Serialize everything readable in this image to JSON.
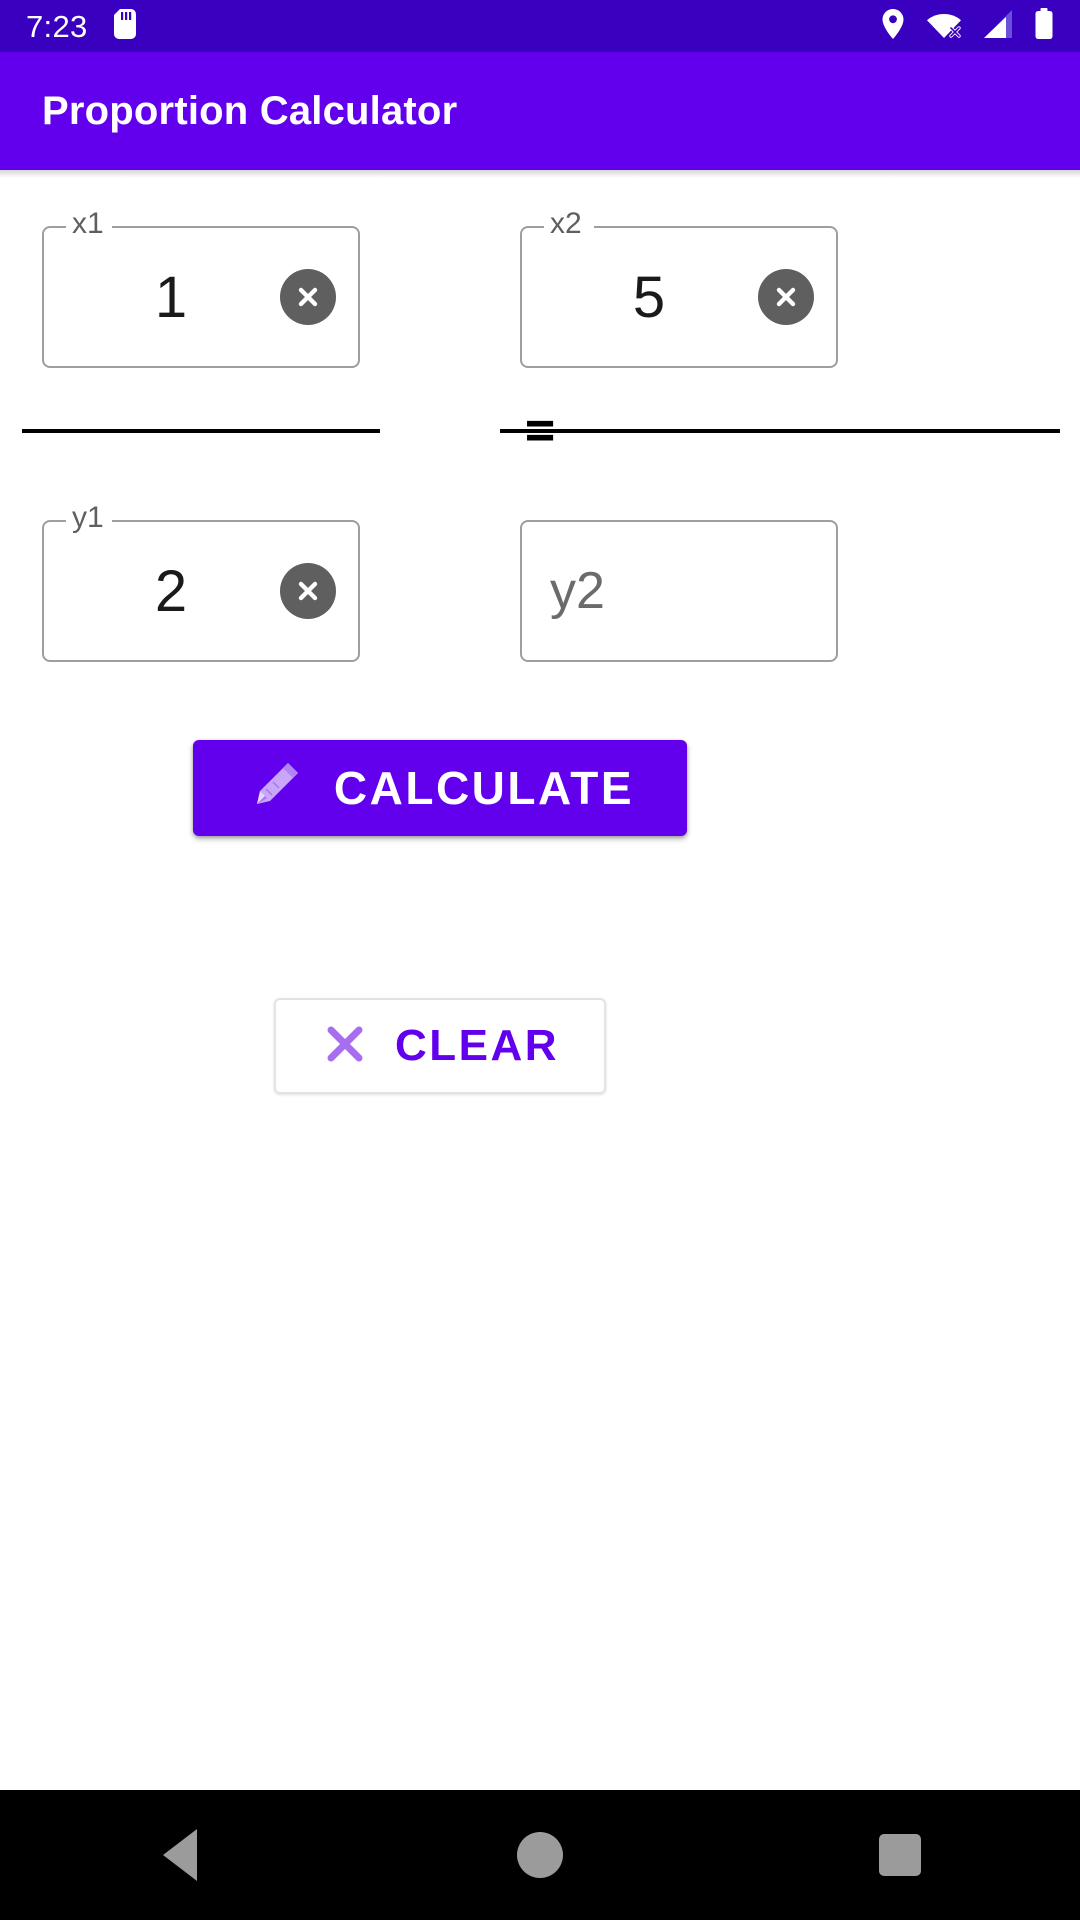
{
  "status_bar": {
    "time": "7:23",
    "icons": {
      "sd_card": "sd-card-icon",
      "location": "location-pin-icon",
      "wifi_off": "wifi-off-icon",
      "signal": "cellular-signal-icon",
      "battery": "battery-full-icon"
    },
    "background_color": "#3A00BF"
  },
  "app_bar": {
    "title": "Proportion Calculator",
    "background_color": "#6200EE",
    "text_color": "#FFFFFF"
  },
  "fields": {
    "x1": {
      "label": "x1",
      "value": "1",
      "placeholder": "x1",
      "has_clear": true,
      "clear_icon": "clear-circle-icon"
    },
    "x2": {
      "label": "x2",
      "value": "5",
      "placeholder": "x2",
      "has_clear": true,
      "clear_icon": "clear-circle-icon"
    },
    "y1": {
      "label": "y1",
      "value": "2",
      "placeholder": "y1",
      "has_clear": true,
      "clear_icon": "clear-circle-icon"
    },
    "y2": {
      "label": "y2",
      "value": "",
      "placeholder": "y2",
      "has_clear": false,
      "clear_icon": "clear-circle-icon"
    }
  },
  "equation": {
    "operator": "=",
    "fraction_bar_color": "#000000"
  },
  "buttons": {
    "calculate": {
      "label": "CALCULATE",
      "icon": "pencil-icon",
      "background_color": "#6200EE",
      "text_color": "#FFFFFF"
    },
    "clear": {
      "label": "CLEAR",
      "icon": "cross-icon",
      "background_color": "#FFFFFF",
      "text_color": "#6200EE"
    }
  },
  "nav_bar": {
    "back": "back-nav-icon",
    "home": "home-nav-icon",
    "recents": "recents-nav-icon",
    "background_color": "#000000"
  }
}
